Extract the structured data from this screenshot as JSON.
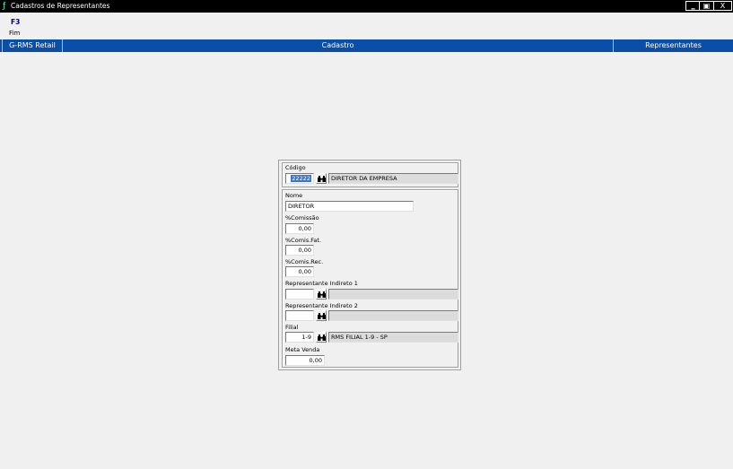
{
  "window": {
    "title": "Cadastros de Representantes",
    "buttons": {
      "minimize": "‗",
      "restore": "▣",
      "close": "X"
    }
  },
  "menu": {
    "key": "F3",
    "label": "Fim"
  },
  "header": {
    "left": "G-RMS Retail",
    "center": "Cadastro",
    "right": "Representantes"
  },
  "form": {
    "codigo": {
      "label": "Código",
      "value": "22222",
      "description": "DIRETOR DA EMPRESA"
    },
    "nome": {
      "label": "Nome",
      "value": "DIRETOR"
    },
    "comissao": {
      "label": "%Comissão",
      "value": "0,00"
    },
    "comis_fat": {
      "label": "%Comis.Fat.",
      "value": "0,00"
    },
    "comis_rec": {
      "label": "%Comis.Rec.",
      "value": "0,00"
    },
    "rep_indireto_1": {
      "label": "Representante Indireto 1",
      "value": "",
      "description": ""
    },
    "rep_indireto_2": {
      "label": "Representante Indireto 2",
      "value": "",
      "description": ""
    },
    "filial": {
      "label": "Filial",
      "value": "1-9",
      "description": "RMS FILIAL 1-9 - SP"
    },
    "meta_venda": {
      "label": "Meta Venda",
      "value": "0,00"
    }
  },
  "icons": {
    "search": "binoculars-icon"
  }
}
